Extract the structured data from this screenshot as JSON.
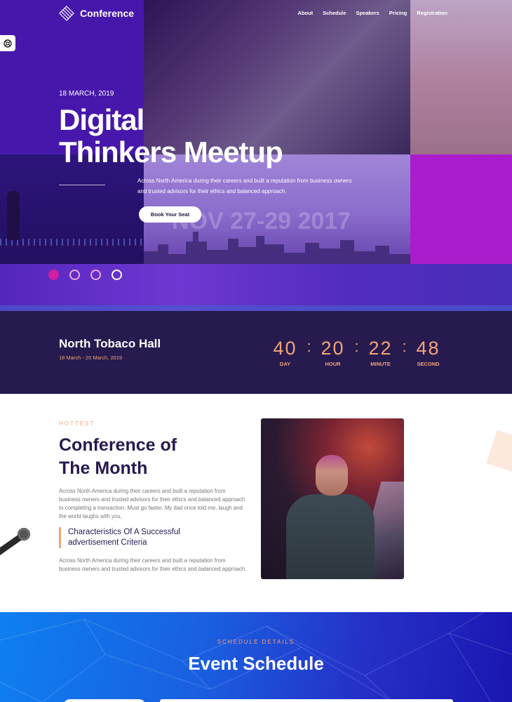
{
  "header": {
    "brand": "Conference",
    "nav": [
      "About",
      "Schedule",
      "Speakers",
      "Pricing",
      "Registration"
    ]
  },
  "hero": {
    "date": "18 MARCH, 2019",
    "title_line1": "Digital",
    "title_line2": "Thinkers Meetup",
    "description": "Across North America during their careers and built a reputation from business owners and trusted advisors for their ethics and balanced approach.",
    "cta": "Book Your Seat",
    "watermark": "NOV 27-29 2017",
    "slides": 4,
    "active_slide": 1
  },
  "venue": {
    "name": "North Tobaco Hall",
    "dates": "18 March - 20 March, 2019"
  },
  "countdown": [
    {
      "value": "40",
      "label": "DAY"
    },
    {
      "value": "20",
      "label": "HOUR"
    },
    {
      "value": "22",
      "label": "MINUTE"
    },
    {
      "value": "48",
      "label": "SECOND"
    }
  ],
  "feature": {
    "eyebrow": "HOTTEST",
    "title_line1": "Conference of",
    "title_line2": "The Month",
    "paragraph1": "Across North America during their careers and built a reputation from business owners and trusted advisors for their ethics and balanced approach to completing a transaction. Must go faster. My dad once told me, laugh and the world laughs with you,",
    "quote": "Characteristics Of A Successful advertisement Criteria",
    "paragraph2": "Across North America during their careers and built a reputation from business owners and trusted advisors for their ethics and balanced approach."
  },
  "schedule": {
    "eyebrow": "SCHEDULE DETAILS",
    "title": "Event Schedule"
  },
  "colors": {
    "accent": "#f4a477",
    "dark": "#261a4e",
    "purple": "#4a18b0",
    "magenta": "#c41fd8",
    "blue": "#0e7ff0"
  }
}
